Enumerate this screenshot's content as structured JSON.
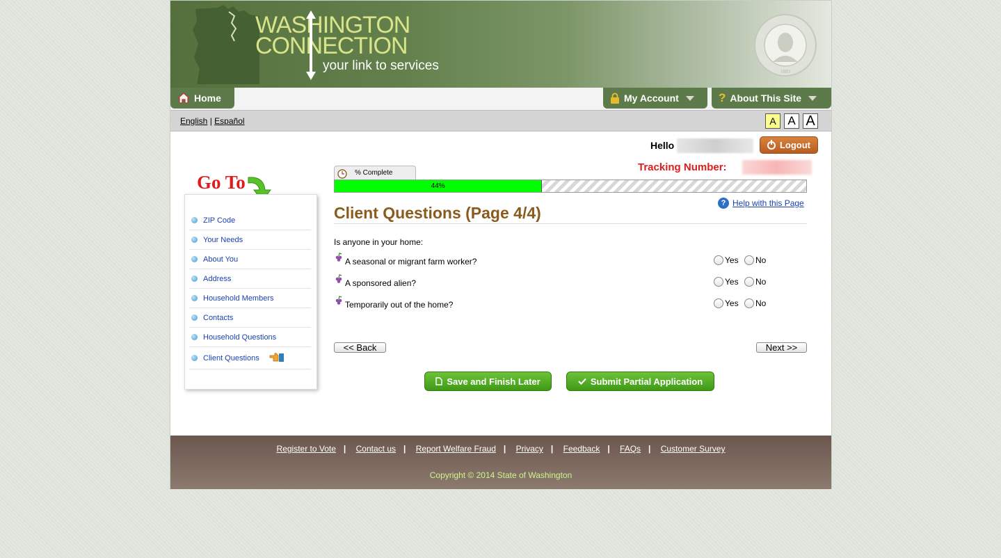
{
  "header": {
    "logo_line1": "WASHINGTON",
    "logo_line2": "CONNECTION",
    "tagline": "your link to services",
    "seal_alt": "The Seal of the State of Washington 1889"
  },
  "nav": {
    "home": "Home",
    "my_account": "My Account",
    "about": "About This Site"
  },
  "langbar": {
    "english": "English",
    "sep": "|",
    "espanol": "Español",
    "text_sizes": [
      "A",
      "A",
      "A"
    ]
  },
  "user": {
    "hello": "Hello",
    "logout": "Logout",
    "tracking_label": "Tracking Number:"
  },
  "sidebar": {
    "goto": "Go To",
    "items": [
      {
        "label": "ZIP Code"
      },
      {
        "label": "Your Needs"
      },
      {
        "label": "About You"
      },
      {
        "label": "Address"
      },
      {
        "label": "Household Members"
      },
      {
        "label": "Contacts"
      },
      {
        "label": "Household Questions"
      },
      {
        "label": "Client Questions"
      }
    ]
  },
  "progress": {
    "tab_label": "% Complete",
    "percent_text": "44%",
    "value": 0.44
  },
  "page": {
    "title": "Client Questions (Page 4/4)",
    "help_link": "Help with this Page",
    "intro": "Is anyone in your home:",
    "questions": [
      {
        "text": "A seasonal or migrant farm worker?",
        "yes": "Yes",
        "no": "No"
      },
      {
        "text": "A sponsored alien?",
        "yes": "Yes",
        "no": "No"
      },
      {
        "text": "Temporarily out of the home?",
        "yes": "Yes",
        "no": "No"
      }
    ]
  },
  "buttons": {
    "back": "<< Back",
    "next": "Next >>",
    "save_later": "Save and Finish Later",
    "submit_partial": "Submit Partial Application"
  },
  "footer": {
    "links": [
      "Register to Vote",
      "Contact us",
      "Report Welfare Fraud",
      "Privacy",
      "Feedback",
      "FAQs",
      "Customer Survey"
    ],
    "copyright": "Copyright © 2014 State of Washington"
  },
  "colors": {
    "header_green": "#5d7a4a",
    "title_brown": "#8b5a1d",
    "progress_green": "#00ff00",
    "alert_red": "#e01b1b",
    "button_green": "#4aa51f",
    "logout_orange": "#c96c2c"
  }
}
